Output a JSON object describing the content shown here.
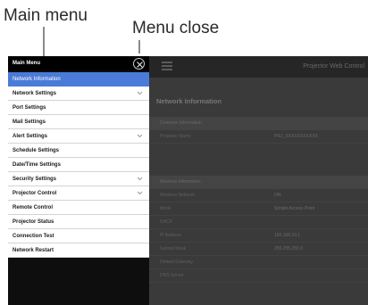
{
  "annotations": {
    "main_menu": "Main menu",
    "menu_close": "Menu close"
  },
  "menu": {
    "title": "Main Menu",
    "close_icon": "close-circle-icon",
    "items": [
      {
        "label": "Network Information",
        "active": true,
        "expandable": false
      },
      {
        "label": "Network Settings",
        "active": false,
        "expandable": true
      },
      {
        "label": "Port Settings",
        "active": false,
        "expandable": false
      },
      {
        "label": "Mail Settings",
        "active": false,
        "expandable": false
      },
      {
        "label": "Alert Settings",
        "active": false,
        "expandable": true
      },
      {
        "label": "Schedule Settings",
        "active": false,
        "expandable": false
      },
      {
        "label": "Date/Time Settings",
        "active": false,
        "expandable": false
      },
      {
        "label": "Security Settings",
        "active": false,
        "expandable": true
      },
      {
        "label": "Projector Control",
        "active": false,
        "expandable": true
      },
      {
        "label": "Remote Control",
        "active": false,
        "expandable": false
      },
      {
        "label": "Projector Status",
        "active": false,
        "expandable": false
      },
      {
        "label": "Connection Test",
        "active": false,
        "expandable": false
      },
      {
        "label": "Network Restart",
        "active": false,
        "expandable": false
      }
    ]
  },
  "header": {
    "app_title": "Projector Web Control",
    "page_icon": "document-icon"
  },
  "page": {
    "heading": "Network Information",
    "groups": [
      {
        "title": "Common Information",
        "rows": [
          {
            "key": "Projector Name",
            "value": "PRJ_XXXXXXXXXXX"
          }
        ]
      },
      {
        "title": "Wireless Information",
        "rows": [
          {
            "key": "Wireless Network",
            "value": "ON"
          },
          {
            "key": "Mode",
            "value": "Simple Access Point"
          },
          {
            "key": "DHCP",
            "value": ""
          },
          {
            "key": "IP Address",
            "value": "192.168.10.1"
          },
          {
            "key": "Subnet Mask",
            "value": "255.255.255.0"
          },
          {
            "key": "Default Gateway",
            "value": ""
          },
          {
            "key": "DNS Server",
            "value": ""
          }
        ]
      }
    ]
  },
  "colors": {
    "active_item": "#4a7bd8",
    "menu_bg": "#ffffff",
    "overlay": "#3b3b3b"
  }
}
